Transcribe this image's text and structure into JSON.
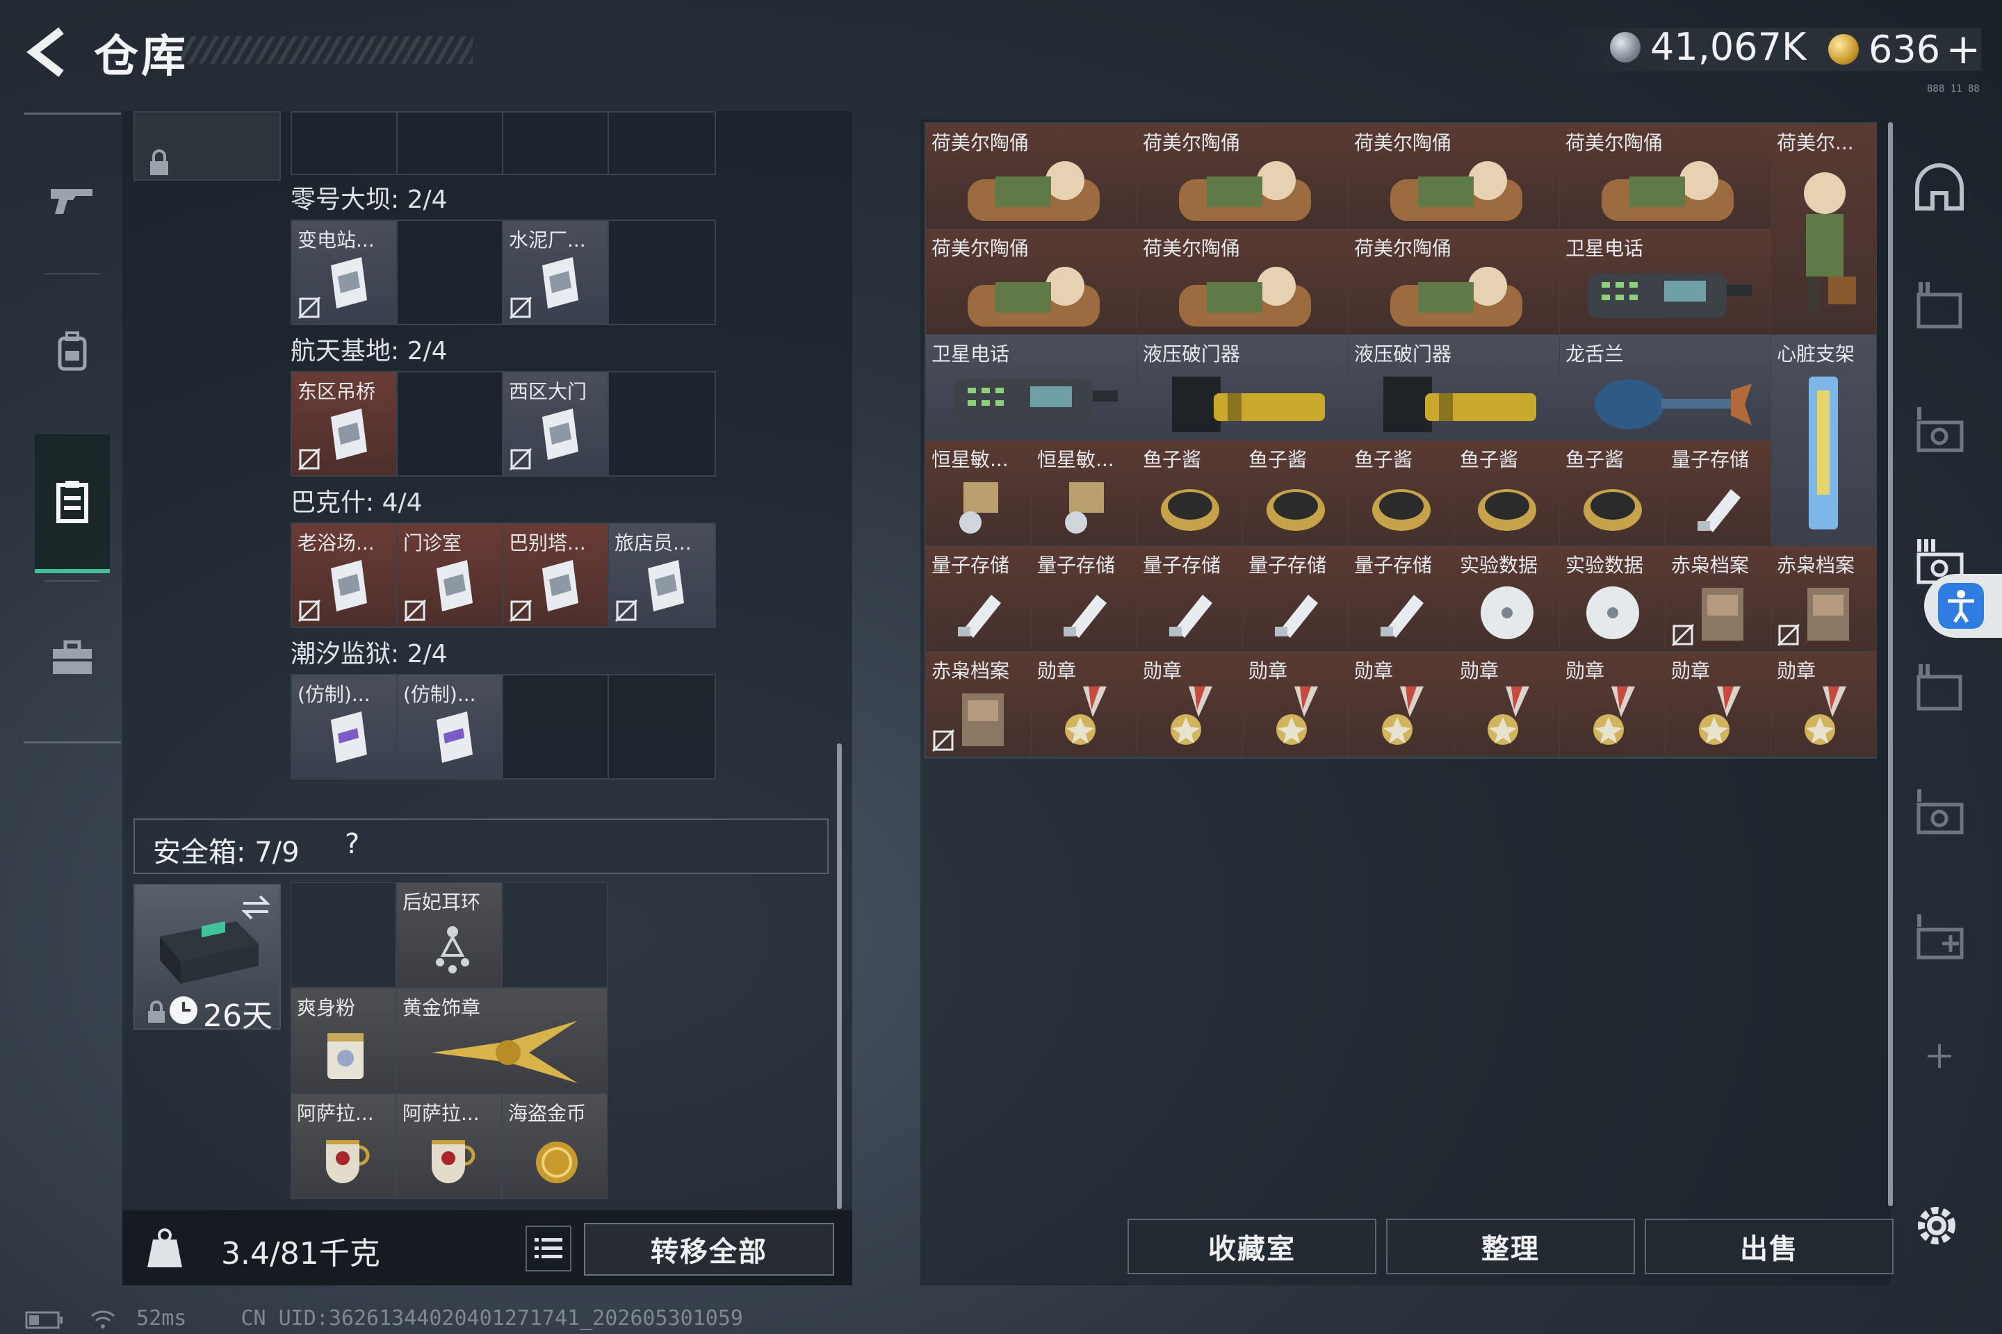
{
  "header": {
    "title": "仓库",
    "currency_silver": "41,067K",
    "currency_gold": "636",
    "currency_add": "+",
    "build_tag": "888 11 88"
  },
  "left_nav": {
    "items": [
      "weapons",
      "backpack",
      "storage",
      "case"
    ],
    "active": "storage"
  },
  "maps": [
    {
      "title": "零号大坝: 2/4",
      "slots": [
        {
          "label": "变电站..."
        },
        {
          "label": ""
        },
        {
          "label": "水泥厂..."
        },
        {
          "label": ""
        }
      ]
    },
    {
      "title": "航天基地: 2/4",
      "slots": [
        {
          "label": "东区吊桥"
        },
        {
          "label": ""
        },
        {
          "label": "西区大门"
        },
        {
          "label": ""
        }
      ]
    },
    {
      "title": "巴克什: 4/4",
      "slots": [
        {
          "label": "老浴场..."
        },
        {
          "label": "门诊室"
        },
        {
          "label": "巴别塔..."
        },
        {
          "label": "旅店员..."
        }
      ]
    },
    {
      "title": "潮汐监狱: 2/4",
      "slots": [
        {
          "label": "(仿制)..."
        },
        {
          "label": "(仿制)..."
        },
        {
          "label": ""
        },
        {
          "label": ""
        }
      ]
    }
  ],
  "safebox": {
    "title": "安全箱: 7/9",
    "help": "?",
    "days": "26天",
    "items": [
      {
        "label": ""
      },
      {
        "label": "后妃耳环"
      },
      {
        "label": ""
      },
      {
        "label": "爽身粉"
      },
      {
        "label": "黄金饰章"
      },
      {
        "label": ""
      },
      {
        "label": "阿萨拉..."
      },
      {
        "label": "阿萨拉..."
      },
      {
        "label": "海盗金币"
      }
    ]
  },
  "bottom_left": {
    "weight": "3.4/81千克",
    "transfer_all": "转移全部"
  },
  "status_bar": {
    "ping": "52ms",
    "uid": "CN UID:36261344020401271741_202605301059"
  },
  "stash": {
    "rows": [
      [
        "荷美尔陶俑",
        "荷美尔陶俑",
        "荷美尔陶俑",
        "荷美尔陶俑",
        "荷美尔..."
      ],
      [
        "荷美尔陶俑",
        "荷美尔陶俑",
        "荷美尔陶俑",
        "卫星电话"
      ],
      [
        "卫星电话",
        "液压破门器",
        "液压破门器",
        "龙舌兰",
        "心脏支架"
      ],
      [
        "恒星敏...",
        "恒星敏...",
        "鱼子酱",
        "鱼子酱",
        "鱼子酱",
        "鱼子酱",
        "鱼子酱",
        "量子存储"
      ],
      [
        "量子存储",
        "量子存储",
        "量子存储",
        "量子存储",
        "量子存储",
        "实验数据",
        "实验数据",
        "赤枭档案",
        "赤枭档案"
      ],
      [
        "赤枭档案",
        "勋章",
        "勋章",
        "勋章",
        "勋章",
        "勋章",
        "勋章",
        "勋章",
        "勋章"
      ]
    ]
  },
  "bottom_right": {
    "collection": "收藏室",
    "sort": "整理",
    "sell": "出售"
  },
  "colors": {
    "accent_green": "#3fc39b",
    "item_red_bg": "#5a3a33",
    "item_gray_bg": "#4b4f5b",
    "access_blue": "#2f7de1"
  }
}
